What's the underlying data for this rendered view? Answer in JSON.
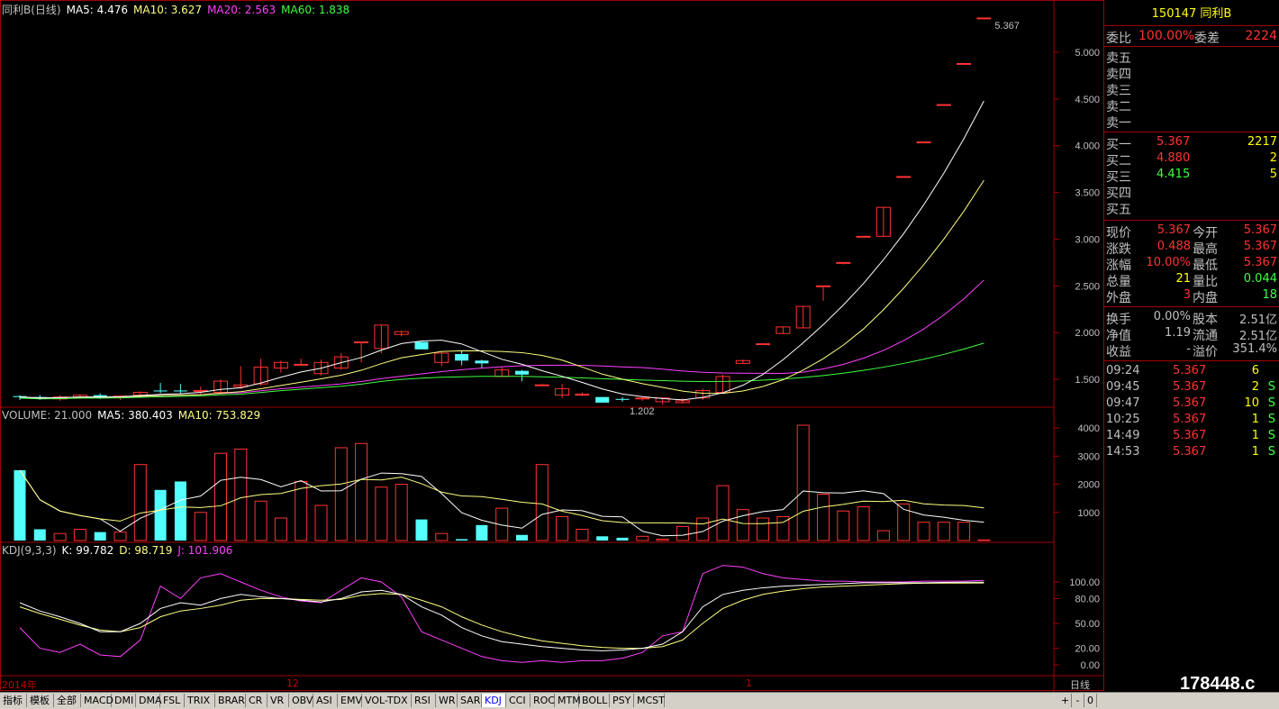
{
  "main": {
    "title": "同利B(日线)",
    "ma5": "MA5: 4.476",
    "ma10": "MA10: 3.627",
    "ma20": "MA20: 2.563",
    "ma60": "MA60: 1.838",
    "high_label": "5.367",
    "low_label": "1.202",
    "yticks": [
      "5.000",
      "4.500",
      "4.000",
      "3.500",
      "3.000",
      "2.500",
      "2.000",
      "1.500"
    ]
  },
  "volume": {
    "title": "VOLUME: 21.000",
    "ma5": "MA5: 380.403",
    "ma10": "MA10: 753.829",
    "yticks": [
      "4000",
      "3000",
      "2000",
      "1000"
    ]
  },
  "kdj": {
    "title": "KDJ(9,3,3)",
    "k": "K: 99.782",
    "d": "D: 98.719",
    "j": "J: 101.906",
    "yticks": [
      "100.00",
      "80.00",
      "50.00",
      "20.00",
      "0.00"
    ]
  },
  "date_axis": {
    "left": "2014年",
    "mid": "12",
    "right": "1",
    "period": "日线"
  },
  "colors": {
    "up": "#ff3232",
    "down": "#54ffff",
    "ma5": "#ffffff",
    "ma10": "#ffff80",
    "ma20": "#ff40ff",
    "ma60": "#40ff40"
  },
  "panel": {
    "code_name": "150147 同利B",
    "wei_bi_label": "委比",
    "wei_bi": "100.00%",
    "wei_cha_label": "委差",
    "wei_cha": "2224",
    "sell": [
      {
        "label": "卖五"
      },
      {
        "label": "卖四"
      },
      {
        "label": "卖三"
      },
      {
        "label": "卖二"
      },
      {
        "label": "卖一"
      }
    ],
    "buy": [
      {
        "label": "买一",
        "price": "5.367",
        "vol": "2217"
      },
      {
        "label": "买二",
        "price": "4.880",
        "vol": "2"
      },
      {
        "label": "买三",
        "price": "4.415",
        "vol": "5"
      },
      {
        "label": "买四",
        "price": "",
        "vol": ""
      },
      {
        "label": "买五",
        "price": "",
        "vol": ""
      }
    ],
    "quote": [
      {
        "l1": "现价",
        "v1": "5.367",
        "l2": "今开",
        "v2": "5.367"
      },
      {
        "l1": "涨跌",
        "v1": "0.488",
        "l2": "最高",
        "v2": "5.367"
      },
      {
        "l1": "涨幅",
        "v1": "10.00%",
        "l2": "最低",
        "v2": "5.367"
      },
      {
        "l1": "总量",
        "v1": "21",
        "l2": "量比",
        "v2": "0.044"
      },
      {
        "l1": "外盘",
        "v1": "3",
        "l2": "内盘",
        "v2": "18"
      }
    ],
    "stats": [
      {
        "l1": "换手",
        "v1": "0.00%",
        "l2": "股本",
        "v2": "2.51亿"
      },
      {
        "l1": "净值",
        "v1": "1.19",
        "l2": "流通",
        "v2": "2.51亿"
      },
      {
        "l1": "收益",
        "v1": "-",
        "l2": "溢价",
        "v2": "351.4%"
      }
    ],
    "ticks": [
      {
        "time": "09:24",
        "price": "5.367",
        "vol": "6",
        "side": ""
      },
      {
        "time": "09:45",
        "price": "5.367",
        "vol": "2",
        "side": "S"
      },
      {
        "time": "09:47",
        "price": "5.367",
        "vol": "10",
        "side": "S"
      },
      {
        "time": "10:25",
        "price": "5.367",
        "vol": "1",
        "side": "S"
      },
      {
        "time": "14:49",
        "price": "5.367",
        "vol": "1",
        "side": "S"
      },
      {
        "time": "14:53",
        "price": "5.367",
        "vol": "1",
        "side": "S"
      }
    ]
  },
  "tabs": [
    "指标",
    "模板",
    "全部",
    "MACD",
    "DMI",
    "DMA",
    "FSL",
    "TRIX",
    "BRAR",
    "CR",
    "VR",
    "OBV",
    "ASI",
    "EMV",
    "VOL-TDX",
    "RSI",
    "WR",
    "SAR",
    "KDJ",
    "CCI",
    "ROC",
    "MTM",
    "BOLL",
    "PSY",
    "MCST"
  ],
  "active_tab": "KDJ",
  "scroll_buttons": [
    "+",
    "-",
    "0"
  ],
  "watermark": "178448.c",
  "chart_data": {
    "type": "candlestick",
    "candles": [
      [
        1.32,
        1.33,
        1.28,
        1.31
      ],
      [
        1.31,
        1.33,
        1.28,
        1.29
      ],
      [
        1.29,
        1.33,
        1.27,
        1.31
      ],
      [
        1.31,
        1.34,
        1.29,
        1.33
      ],
      [
        1.33,
        1.35,
        1.29,
        1.31
      ],
      [
        1.31,
        1.33,
        1.28,
        1.32
      ],
      [
        1.33,
        1.37,
        1.31,
        1.36
      ],
      [
        1.38,
        1.46,
        1.35,
        1.37
      ],
      [
        1.38,
        1.45,
        1.34,
        1.37
      ],
      [
        1.37,
        1.42,
        1.33,
        1.38
      ],
      [
        1.36,
        1.5,
        1.34,
        1.48
      ],
      [
        1.42,
        1.64,
        1.4,
        1.44
      ],
      [
        1.45,
        1.72,
        1.43,
        1.63
      ],
      [
        1.62,
        1.7,
        1.57,
        1.68
      ],
      [
        1.66,
        1.72,
        1.64,
        1.66
      ],
      [
        1.56,
        1.71,
        1.54,
        1.68
      ],
      [
        1.62,
        1.78,
        1.6,
        1.74
      ],
      [
        1.9,
        1.9,
        1.68,
        1.9
      ],
      [
        1.83,
        2.08,
        1.78,
        2.08
      ],
      [
        1.98,
        2.02,
        1.96,
        2.01
      ],
      [
        1.9,
        1.9,
        1.82,
        1.82
      ],
      [
        1.68,
        1.8,
        1.64,
        1.78
      ],
      [
        1.77,
        1.8,
        1.65,
        1.7
      ],
      [
        1.7,
        1.71,
        1.62,
        1.67
      ],
      [
        1.53,
        1.64,
        1.53,
        1.6
      ],
      [
        1.59,
        1.6,
        1.48,
        1.55
      ],
      [
        1.44,
        1.45,
        1.44,
        1.44
      ],
      [
        1.33,
        1.45,
        1.3,
        1.4
      ],
      [
        1.34,
        1.36,
        1.32,
        1.34
      ],
      [
        1.31,
        1.31,
        1.25,
        1.25
      ],
      [
        1.29,
        1.31,
        1.26,
        1.28
      ],
      [
        1.29,
        1.31,
        1.27,
        1.3
      ],
      [
        1.26,
        1.3,
        1.23,
        1.3
      ],
      [
        1.25,
        1.3,
        1.24,
        1.27
      ],
      [
        1.3,
        1.4,
        1.28,
        1.38
      ],
      [
        1.36,
        1.55,
        1.35,
        1.53
      ],
      [
        1.67,
        1.71,
        1.67,
        1.7
      ],
      [
        1.88,
        1.88,
        1.87,
        1.88
      ],
      [
        1.99,
        2.06,
        1.99,
        2.06
      ],
      [
        2.05,
        2.28,
        2.05,
        2.28
      ],
      [
        2.5,
        2.5,
        2.34,
        2.5
      ],
      [
        2.75,
        2.75,
        2.73,
        2.75
      ],
      [
        3.03,
        3.03,
        3.03,
        3.03
      ],
      [
        3.03,
        3.34,
        3.03,
        3.34
      ],
      [
        3.67,
        3.67,
        3.67,
        3.67
      ],
      [
        4.04,
        4.04,
        4.04,
        4.04
      ],
      [
        4.44,
        4.44,
        4.44,
        4.44
      ],
      [
        4.88,
        4.88,
        4.88,
        4.88
      ],
      [
        5.367,
        5.367,
        5.367,
        5.367
      ]
    ],
    "volume": [
      2500,
      400,
      250,
      400,
      300,
      300,
      2700,
      1800,
      2100,
      1000,
      3100,
      3250,
      1400,
      800,
      2100,
      1250,
      3300,
      3450,
      1900,
      2000,
      750,
      250,
      50,
      550,
      1150,
      200,
      2700,
      850,
      400,
      150,
      100,
      150,
      50,
      500,
      800,
      1950,
      1100,
      800,
      850,
      4100,
      1650,
      1050,
      1200,
      350,
      1300,
      650,
      650,
      650,
      21
    ],
    "kdj": {
      "k": [
        75,
        65,
        58,
        50,
        40,
        40,
        50,
        68,
        75,
        72,
        80,
        85,
        82,
        80,
        78,
        76,
        80,
        88,
        90,
        85,
        70,
        60,
        45,
        35,
        28,
        25,
        22,
        20,
        18,
        17,
        18,
        20,
        25,
        40,
        70,
        85,
        90,
        93,
        95,
        96,
        97,
        98,
        99,
        99,
        99,
        99,
        99.5,
        99.7,
        99.782
      ],
      "d": [
        70,
        62,
        55,
        48,
        42,
        40,
        45,
        58,
        65,
        68,
        72,
        78,
        80,
        80,
        79,
        78,
        79,
        84,
        86,
        85,
        78,
        70,
        58,
        48,
        40,
        34,
        29,
        26,
        23,
        21,
        20,
        20,
        22,
        30,
        50,
        68,
        78,
        85,
        89,
        92,
        94,
        95,
        96,
        97,
        98,
        98.5,
        98.6,
        98.7,
        98.719
      ],
      "j": [
        45,
        20,
        15,
        25,
        12,
        10,
        30,
        95,
        80,
        105,
        110,
        100,
        90,
        82,
        77,
        75,
        90,
        105,
        100,
        82,
        40,
        30,
        20,
        10,
        5,
        3,
        5,
        3,
        5,
        5,
        8,
        15,
        35,
        40,
        110,
        120,
        118,
        110,
        105,
        103,
        101,
        101,
        100,
        100,
        100,
        101,
        101,
        101,
        101.906
      ]
    }
  }
}
